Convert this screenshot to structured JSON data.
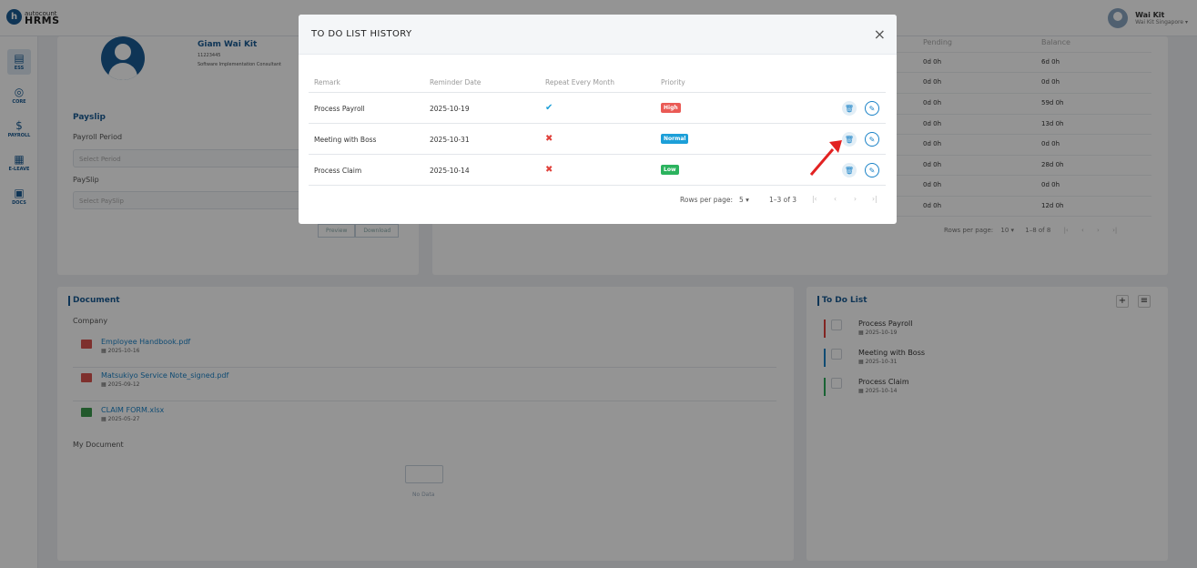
{
  "topbar": {
    "logo_letter": "h",
    "logo_small": "autocount",
    "logo_main": "HRMS",
    "user_name": "Wai Kit",
    "user_company": "Wai Kit Singapore"
  },
  "sidebar": {
    "items": [
      {
        "icon": "▤",
        "label": "ESS"
      },
      {
        "icon": "◎",
        "label": "CORE"
      },
      {
        "icon": "$",
        "label": "PAYROLL"
      },
      {
        "icon": "▦",
        "label": "E-LEAVE"
      },
      {
        "icon": "▣",
        "label": "DOCS"
      }
    ]
  },
  "profile": {
    "name": "Giam Wai Kit",
    "id": "11223445",
    "title": "Software Implementation Consultant"
  },
  "payslip": {
    "title": "Payslip",
    "period_label": "Payroll Period",
    "period_placeholder": "Select Period",
    "payslip_label": "PaySlip",
    "payslip_placeholder": "Select PaySlip",
    "preview_label": "Preview",
    "download_label": "Download"
  },
  "leave": {
    "col_pending": "Pending",
    "col_balance": "Balance",
    "rows": [
      {
        "pending": "0d 0h",
        "balance": "6d 0h"
      },
      {
        "pending": "0d 0h",
        "balance": "0d 0h"
      },
      {
        "pending": "0d 0h",
        "balance": "59d 0h"
      },
      {
        "pending": "0d 0h",
        "balance": "13d 0h"
      },
      {
        "pending": "0d 0h",
        "balance": "0d 0h"
      },
      {
        "pending": "0d 0h",
        "balance": "28d 0h"
      },
      {
        "pending": "0d 0h",
        "balance": "0d 0h"
      },
      {
        "pending": "0d 0h",
        "balance": "12d 0h"
      }
    ],
    "rows_per_page_label": "Rows per page:",
    "rows_per_page": "10",
    "range": "1–8 of 8"
  },
  "document": {
    "title": "Document",
    "company_label": "Company",
    "files": [
      {
        "name": "Employee Handbook.pdf",
        "date": "2025-10-16",
        "color": "#d9534f"
      },
      {
        "name": "Matsukiyo Service Note_signed.pdf",
        "date": "2025-09-12",
        "color": "#d9534f"
      },
      {
        "name": "CLAIM FORM.xlsx",
        "date": "2025-05-27",
        "color": "#3c9a4c"
      }
    ],
    "my_document_label": "My Document",
    "no_data": "No Data"
  },
  "todo": {
    "title": "To Do List",
    "add_icon": "+",
    "list_icon": "≡",
    "items": [
      {
        "title": "Process Payroll",
        "date": "2025-10-19",
        "color": "#e0413b"
      },
      {
        "title": "Meeting with Boss",
        "date": "2025-10-31",
        "color": "#1a82c7"
      },
      {
        "title": "Process Claim",
        "date": "2025-10-14",
        "color": "#2bab5a"
      }
    ]
  },
  "modal": {
    "title": "TO DO LIST HISTORY",
    "close": "×",
    "headers": {
      "remark": "Remark",
      "reminder_date": "Reminder Date",
      "repeat": "Repeat Every Month",
      "priority": "Priority"
    },
    "rows": [
      {
        "remark": "Process Payroll",
        "date": "2025-10-19",
        "repeat": "✔",
        "priority": "High",
        "priority_color": "#ea5a55"
      },
      {
        "remark": "Meeting with Boss",
        "date": "2025-10-31",
        "repeat": "✖",
        "priority": "Normal",
        "priority_color": "#1c9fd8"
      },
      {
        "remark": "Process Claim",
        "date": "2025-10-14",
        "repeat": "✖",
        "priority": "Low",
        "priority_color": "#2bb35e"
      }
    ],
    "rows_per_page_label": "Rows per page:",
    "rows_per_page": "5",
    "range": "1–3 of 3"
  },
  "icons": {
    "delete": "🗑",
    "edit": "✎",
    "first": "|‹",
    "prev": "‹",
    "next": "›",
    "last": "›|",
    "dropdown": "▾",
    "calendar": "▦"
  }
}
